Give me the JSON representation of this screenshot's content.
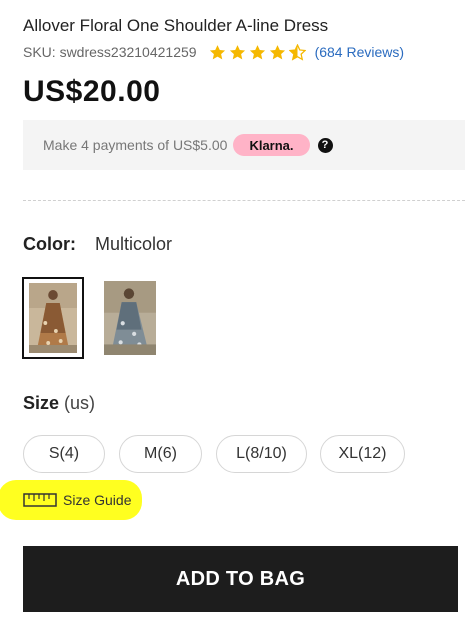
{
  "product": {
    "title": "Allover Floral One Shoulder A-line Dress",
    "sku": "SKU: swdress23210421259",
    "rating": 4.5,
    "rating_max": 5,
    "reviews": "(684 Reviews)",
    "price": "US$20.00"
  },
  "klarna": {
    "text": "Make 4 payments of US$5.00",
    "badge": "Klarna."
  },
  "color": {
    "label": "Color:",
    "value": "Multicolor",
    "swatches": [
      {
        "name": "floral-brown",
        "selected": true
      },
      {
        "name": "floral-blue",
        "selected": false
      }
    ]
  },
  "size": {
    "label": "Size",
    "unit": "(us)",
    "options": [
      "S(4)",
      "M(6)",
      "L(8/10)",
      "XL(12)"
    ],
    "guide": "Size Guide"
  },
  "cta": {
    "label": "ADD TO BAG"
  },
  "colors": {
    "star": "#f5b800",
    "link": "#2a6bbf",
    "klarna_pink": "#ffb3c7",
    "highlight": "#ffff20",
    "cta_bg": "#1d1d1d"
  },
  "icons": [
    "star-icon",
    "info-icon",
    "ruler-icon"
  ]
}
